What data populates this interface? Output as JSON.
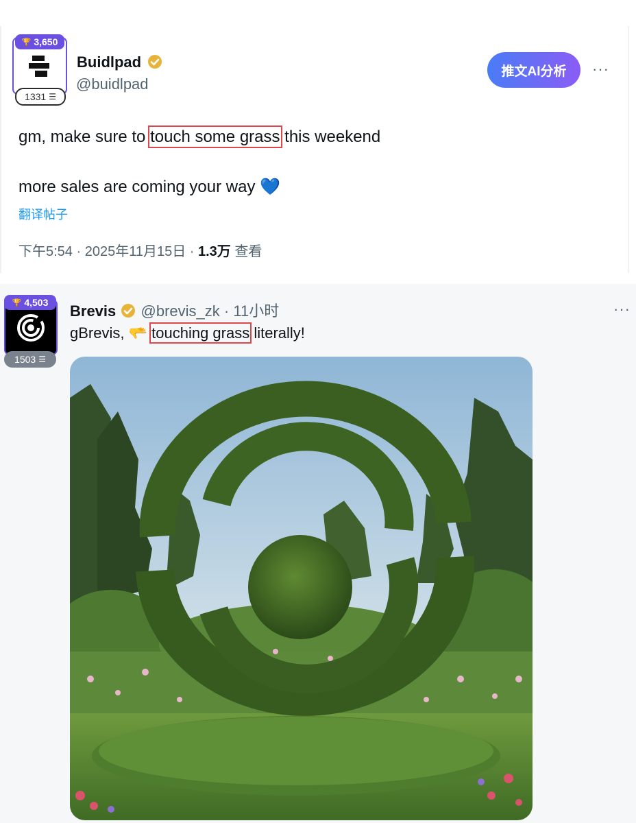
{
  "tweet1": {
    "avatar_badge_count": "3,650",
    "avatar_follow_count": "1331",
    "display_name": "Buidlpad",
    "handle": "@buidlpad",
    "ai_button_label": "推文AI分析",
    "more_label": "···",
    "line1_before": "gm, make sure to ",
    "line1_highlight": "touch some grass",
    "line1_after": " this weekend",
    "line2": "more sales are coming your way",
    "line2_emoji": "💙",
    "translate_label": "翻译帖子",
    "time": "下午5:54",
    "sep1": " · ",
    "date": "2025年11月15日",
    "sep2": " · ",
    "views_count": "1.3万",
    "views_label": " 查看"
  },
  "tweet2": {
    "avatar_badge_count": "4,503",
    "avatar_follow_count": "1503",
    "display_name": "Brevis",
    "handle": "@brevis_zk",
    "sep": " · ",
    "time_ago": "11小时",
    "more_label": "···",
    "text_before": "gBrevis, ",
    "text_emoji": "🫳",
    "text_highlight": "touching grass",
    "text_after": " literally!"
  },
  "colors": {
    "badge_purple": "#6a4fe0",
    "verified_gold": "#e8b339",
    "highlight_red": "#e0454b",
    "link_blue": "#1d9bf0",
    "heart_blue": "#5aa7ee"
  }
}
